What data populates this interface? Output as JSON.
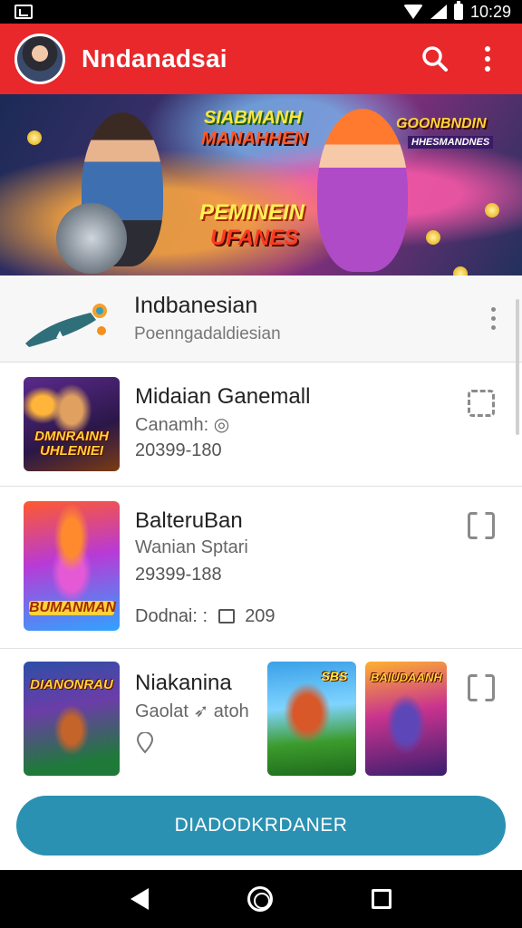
{
  "status_bar": {
    "time": "10:29"
  },
  "app_bar": {
    "title": "Nndanadsai",
    "icons": [
      "avatar",
      "search-icon",
      "more-vertical-icon"
    ]
  },
  "banner": {
    "top_line_1": "Siabmanh",
    "top_line_2": "Manahhen",
    "main_line_1": "Peminein",
    "main_line_2": "Ufanes",
    "right_badge": "Goonbndin",
    "right_sub": "Hhesmandnes"
  },
  "channel": {
    "name": "Indbanesian",
    "subtitle": "Poenngadaldiesian"
  },
  "items": [
    {
      "title": "Midaian Ganemall",
      "subtitle": "Canamh: ◎",
      "meta": "20399-180",
      "thumb_label": "Dmnrainh Uhleniei",
      "icon": "select-dashed-icon"
    },
    {
      "title": "BalteruBan",
      "subtitle": "Wanian Sptari",
      "meta": "29399-188",
      "extra_label": "Dodnai: :",
      "extra_value": "209",
      "thumb_label": "Bumanman",
      "icon": "select-corners-icon"
    },
    {
      "title": "Niakanina",
      "subtitle": "Gaolat ➶ atoh",
      "thumb_label": "Dianonrau",
      "thumb2_label": "SBS",
      "thumb3_label": "Baiudaanh",
      "icon": "select-corners-icon"
    }
  ],
  "bottom_button": {
    "label": "DIADODKRDANER"
  },
  "nav": [
    "back-icon",
    "home-icon",
    "recents-icon"
  ],
  "colors": {
    "app_bar": "#e8282b",
    "primary_button": "#2a91b2"
  }
}
